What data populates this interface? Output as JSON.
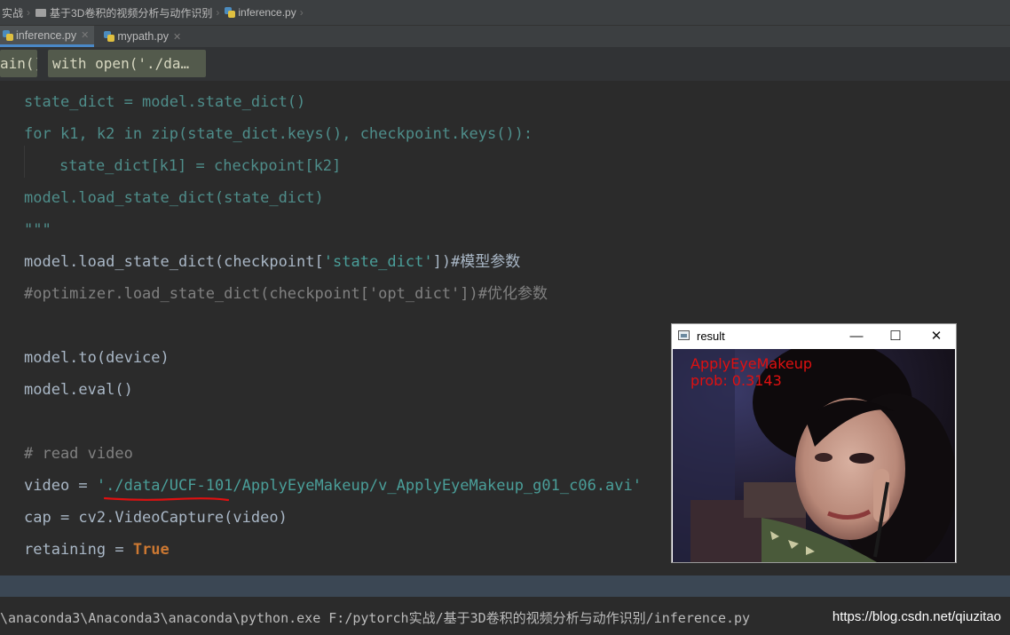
{
  "breadcrumb": {
    "items": [
      "实战",
      "基于3D卷积的视频分析与动作识别",
      "inference.py"
    ]
  },
  "tabs": [
    {
      "label": "inference.py",
      "active": true
    },
    {
      "label": "mypath.py",
      "active": false
    }
  ],
  "code_nav": {
    "chips": [
      "ain()",
      "with open('./da…"
    ]
  },
  "editor": {
    "lines": {
      "l1": "state_dict = model.state_dict()",
      "l2": "for k1, k2 in zip(state_dict.keys(), checkpoint.keys()):",
      "l3": "state_dict[k1] = checkpoint[k2]",
      "l4": "model.load_state_dict(state_dict)",
      "l5": "\"\"\"",
      "l6a": "model.load_state_dict(checkpoint[",
      "l6b": "'state_dict'",
      "l6c": "])#模型参数",
      "l7": "#optimizer.load_state_dict(checkpoint['opt_dict'])#优化参数",
      "l8": "model.to(device)",
      "l9": "model.eval()",
      "l10": "# read video",
      "l11a": "video = ",
      "l11b": "'./data/UCF-101/ApplyEyeMakeup/v_ApplyEyeMakeup_g01_c06.avi'",
      "l12": "cap = cv2.VideoCapture(video)",
      "l13a": "retaining = ",
      "l13b": "True"
    }
  },
  "console": {
    "command": "\\anaconda3\\Anaconda3\\anaconda\\python.exe F:/pytorch实战/基于3D卷积的视频分析与动作识别/inference.py"
  },
  "watermark": "https://blog.csdn.net/qiuzitao",
  "result_window": {
    "title": "result",
    "minimize": "—",
    "maximize": "☐",
    "close": "✕",
    "label_class": "ApplyEyeMakeup",
    "label_prob": "prob: 0.3143"
  },
  "colors": {
    "editor_bg": "#2b2b2b",
    "keyword": "#cc7832",
    "string": "#6a8759",
    "annotation_underline": "#e01010",
    "overlay_text": "#e01010"
  }
}
